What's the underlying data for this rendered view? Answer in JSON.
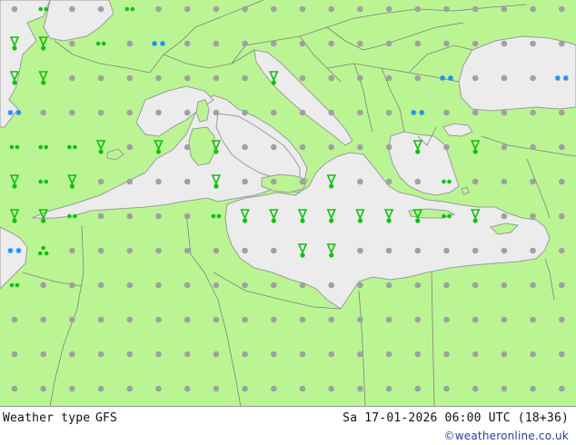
{
  "footer": {
    "product_label": "Weather type",
    "model_label": "GFS",
    "valid_time": "Sa 17-01-2026 06:00 UTC (18+36)",
    "credit": "©weatheronline.co.uk"
  },
  "colors": {
    "land": "#bbf593",
    "sea": "#ececec",
    "border": "#7f7f7f",
    "coast": "#9b9b9b",
    "dry_dot": "#a0a0a0",
    "rain": "#10c010",
    "snow": "#1a8cff",
    "thunder": "#e03a1a"
  },
  "legend_icons": [
    "dry-dot",
    "rain-shower-icon",
    "drizzle-icon",
    "snow-icon",
    "thunderstorm-icon",
    "fog-icon"
  ]
}
